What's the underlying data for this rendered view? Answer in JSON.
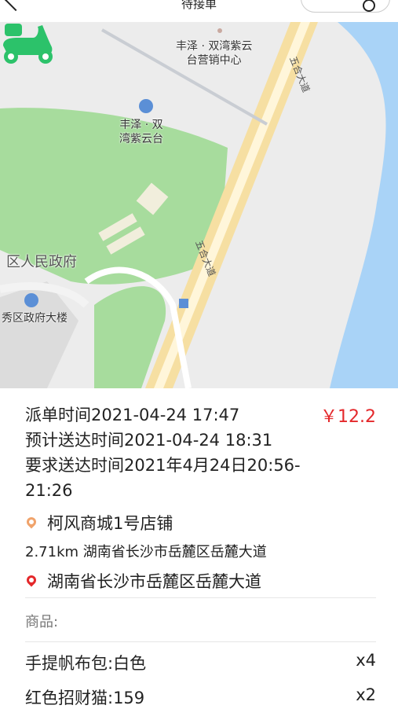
{
  "header": {
    "title": "待接单"
  },
  "map": {
    "poi1": "丰泽 · 双湾紫云\n台营销中心",
    "poi2": "丰泽 · 双\n湾紫云台",
    "poi3": "区人民政府",
    "poi4": "秀区政府大楼",
    "road1": "五合大道",
    "road2": "五合大道",
    "rider_icon": "scooter-icon"
  },
  "order": {
    "dispatch_time": "派单时间2021-04-24 17:47",
    "price": "￥12.2",
    "eta": "预计送达时间2021-04-24 18:31",
    "required_time": "要求送达时间2021年4月24日20:56-\n21:26",
    "shop_name": "柯风商城1号店铺",
    "distance_addr": "2.71km 湖南省长沙市岳麓区岳麓大道",
    "dest_addr": "湖南省长沙市岳麓区岳麓大道"
  },
  "goods": {
    "header": "商品:",
    "items": [
      {
        "name": "手提帆布包:白色",
        "qty": "x4"
      },
      {
        "name": "红色招财猫:159",
        "qty": "x2"
      }
    ]
  },
  "colors": {
    "price": "#e4282b",
    "rider": "#2cc26a",
    "shop_pin": "#f0a36b",
    "dest_pin": "#e4282b"
  }
}
